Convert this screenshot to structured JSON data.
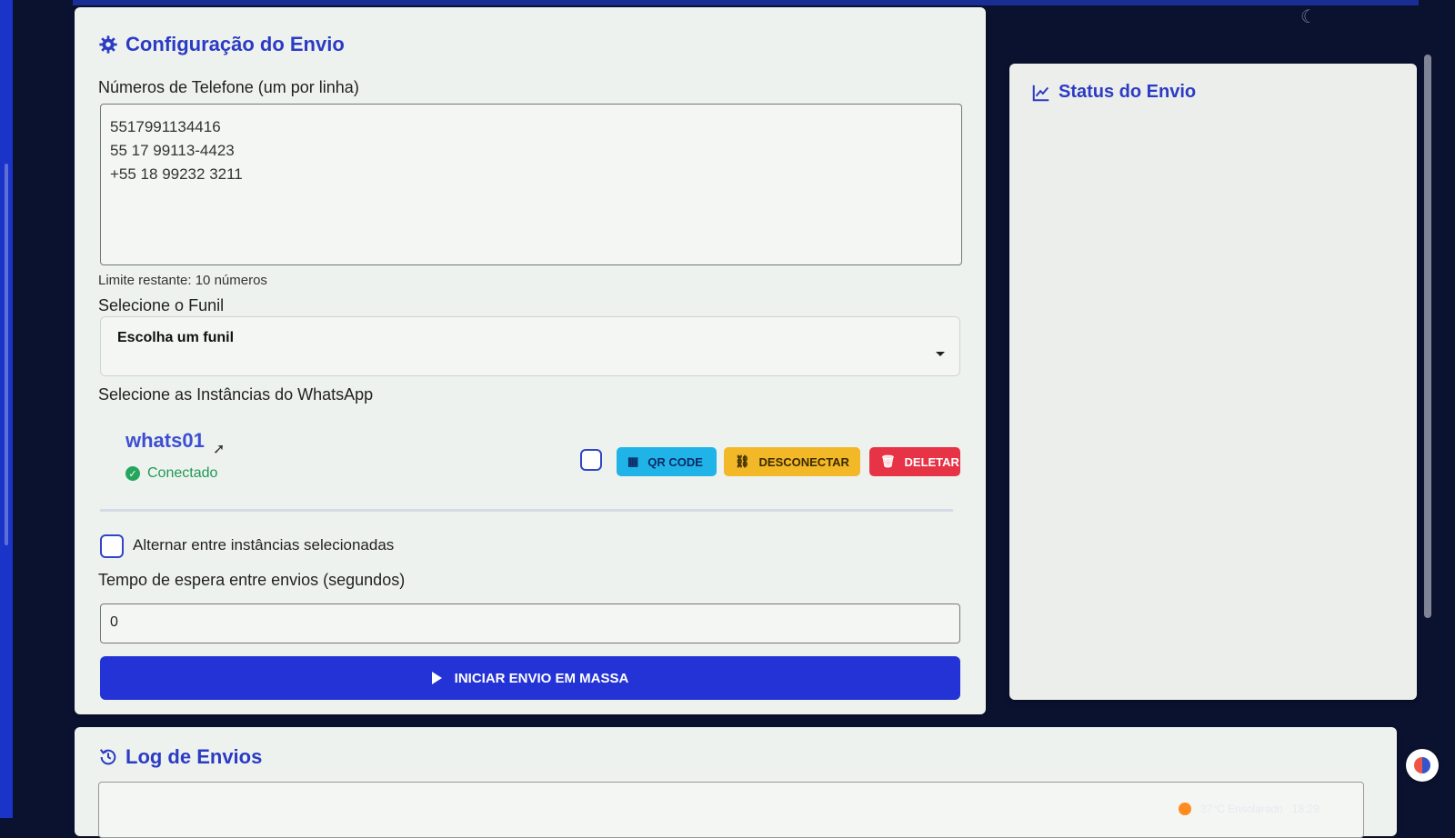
{
  "config_card": {
    "title": "Configuração do Envio",
    "phones_label": "Números de Telefone (um por linha)",
    "phones": [
      "5517991134416",
      "55 17 99113-4423",
      "+55 18 99232 3211"
    ],
    "limit_text": "Limite restante: 10 números",
    "funnel_label": "Selecione o Funil",
    "funnel_selected": "Escolha um funil",
    "instances_label": "Selecione as Instâncias do WhatsApp",
    "instance": {
      "name": "whats01",
      "status": "Conectado",
      "qr_label": "QR CODE",
      "disconnect_label": "DESCONECTAR",
      "delete_label": "DELETAR"
    },
    "alternate_label": "Alternar entre instâncias selecionadas",
    "wait_label": "Tempo de espera entre envios (segundos)",
    "wait_value": "0",
    "start_button": "INICIAR ENVIO EM MASSA"
  },
  "status_card": {
    "title": "Status do Envio"
  },
  "log_card": {
    "title": "Log de Envios"
  },
  "taskbar": {
    "weather": "37°C Ensolarado",
    "time": "18:29"
  },
  "colors": {
    "accent": "#2433d6",
    "qr": "#1fb3e8",
    "disconnect": "#f3b828",
    "delete": "#e63346",
    "connected": "#25a65c"
  },
  "icons": [
    "gear-icon",
    "chart-line-icon",
    "history-icon",
    "check-circle-icon",
    "qr-icon",
    "unlink-icon",
    "trash-icon",
    "play-icon",
    "moon-icon",
    "cursor-icon"
  ]
}
